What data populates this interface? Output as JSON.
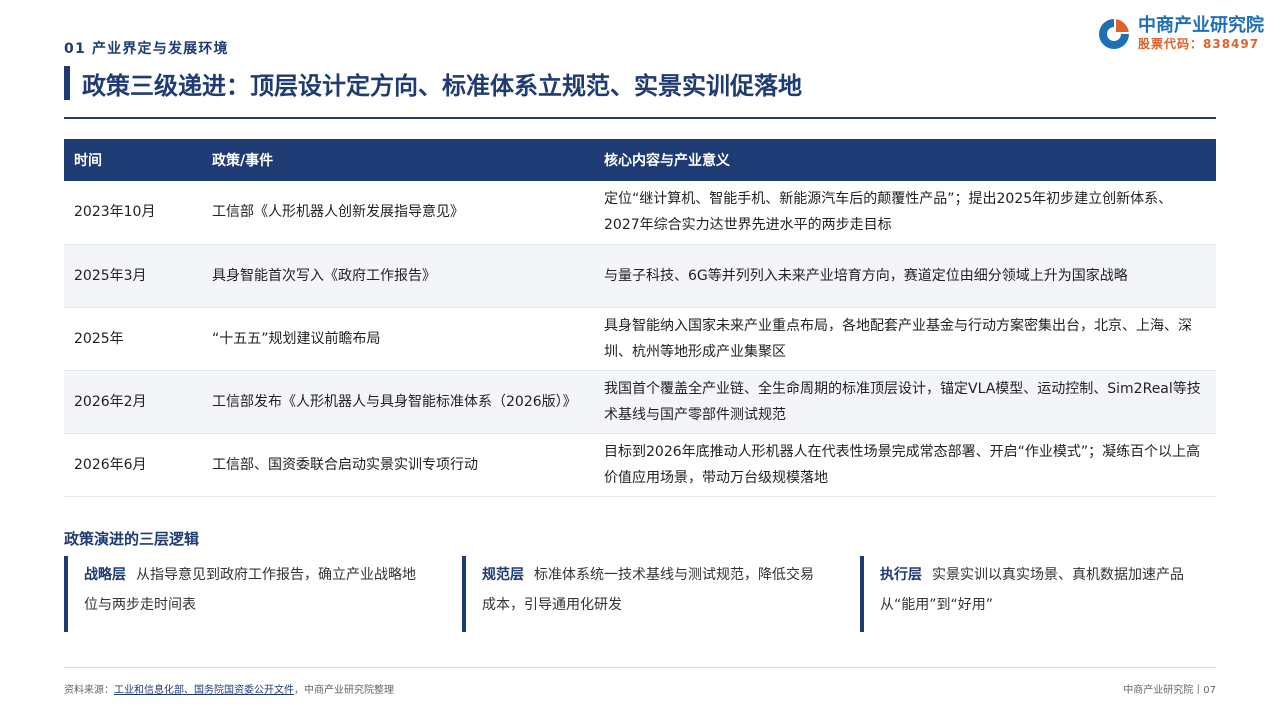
{
  "header": {
    "section": "01 产业界定与发展环境",
    "title": "政策三级递进：顶层设计定方向、标准体系立规范、实景实训促落地"
  },
  "logo": {
    "name": "中商产业研究院",
    "code": "股票代码：838497",
    "colors": {
      "blue": "#1f6fb5",
      "orange": "#e0622a"
    }
  },
  "table": {
    "headers": [
      "时间",
      "政策/事件",
      "核心内容与产业意义"
    ],
    "rows": [
      {
        "time": "2023年10月",
        "event": "工信部《人形机器人创新发展指导意见》",
        "content": "定位“继计算机、智能手机、新能源汽车后的颠覆性产品”；提出2025年初步建立创新体系、2027年综合实力达世界先进水平的两步走目标"
      },
      {
        "time": "2025年3月",
        "event": "具身智能首次写入《政府工作报告》",
        "content": "与量子科技、6G等并列列入未来产业培育方向，赛道定位由细分领域上升为国家战略"
      },
      {
        "time": "2025年",
        "event": "“十五五”规划建议前瞻布局",
        "content": "具身智能纳入国家未来产业重点布局，各地配套产业基金与行动方案密集出台，北京、上海、深圳、杭州等地形成产业集聚区"
      },
      {
        "time": "2026年2月",
        "event": "工信部发布《人形机器人与具身智能标准体系（2026版）》",
        "content": "我国首个覆盖全产业链、全生命周期的标准顶层设计，锚定VLA模型、运动控制、Sim2Real等技术基线与国产零部件测试规范"
      },
      {
        "time": "2026年6月",
        "event": "工信部、国资委联合启动实景实训专项行动",
        "content": "目标到2026年底推动人形机器人在代表性场景完成常态部署、开启“作业模式”；凝练百个以上高价值应用场景，带动万台级规模落地"
      }
    ]
  },
  "logic": {
    "title": "政策演进的三层逻辑",
    "cards": [
      {
        "key": "战略层",
        "text": "从指导意见到政府工作报告，确立产业战略地位与两步走时间表"
      },
      {
        "key": "规范层",
        "text": "标准体系统一技术基线与测试规范，降低交易成本，引导通用化研发"
      },
      {
        "key": "执行层",
        "text": "实景实训以真实场景、真机数据加速产品从“能用”到“好用”"
      }
    ]
  },
  "footer": {
    "source_prefix": "资料来源：",
    "source_link": "工业和信息化部、国务院国资委公开文件",
    "source_suffix": "，中商产业研究院整理",
    "page": "中商产业研究院丨07"
  },
  "colors": {
    "primary": "#1f3b73",
    "row_alt": "#f3f5f9"
  }
}
